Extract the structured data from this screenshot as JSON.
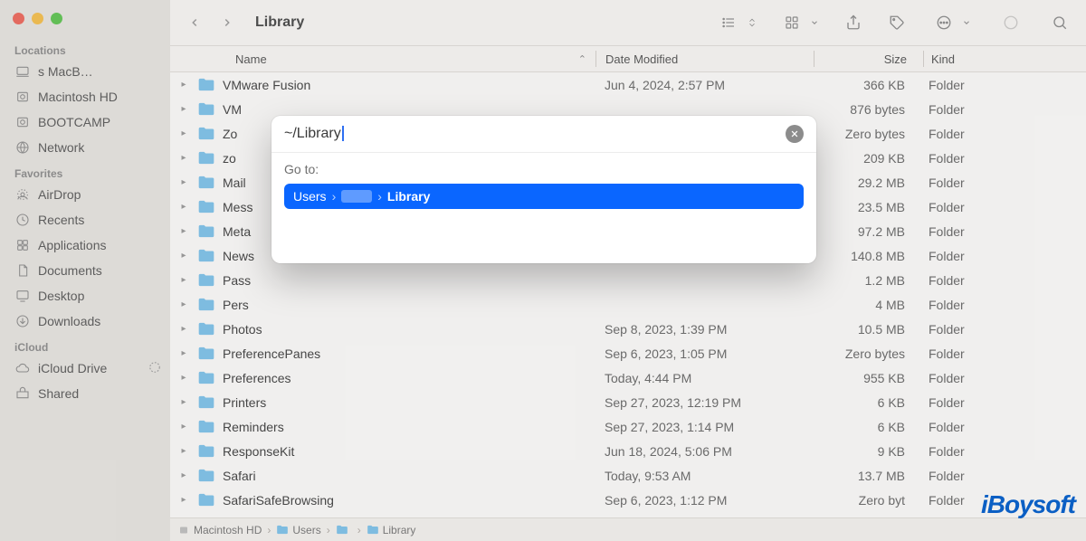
{
  "window": {
    "title": "Library"
  },
  "traffic_lights": {
    "colors": [
      "#ed6a5e",
      "#f5bf4f",
      "#61c554"
    ]
  },
  "sidebar": {
    "sections": [
      {
        "title": "Locations",
        "items": [
          {
            "label": "s MacB…",
            "icon": "laptop"
          },
          {
            "label": "Macintosh HD",
            "icon": "hdd"
          },
          {
            "label": "BOOTCAMP",
            "icon": "hdd"
          },
          {
            "label": "Network",
            "icon": "globe"
          }
        ]
      },
      {
        "title": "Favorites",
        "items": [
          {
            "label": "AirDrop",
            "icon": "airdrop"
          },
          {
            "label": "Recents",
            "icon": "clock"
          },
          {
            "label": "Applications",
            "icon": "apps"
          },
          {
            "label": "Documents",
            "icon": "doc"
          },
          {
            "label": "Desktop",
            "icon": "desktop"
          },
          {
            "label": "Downloads",
            "icon": "download"
          }
        ]
      },
      {
        "title": "iCloud",
        "items": [
          {
            "label": "iCloud Drive",
            "icon": "icloud",
            "badge": "sync"
          },
          {
            "label": "Shared",
            "icon": "shared"
          }
        ]
      }
    ]
  },
  "columns": {
    "name": "Name",
    "date": "Date Modified",
    "size": "Size",
    "kind": "Kind"
  },
  "rows": [
    {
      "name": "VMware Fusion",
      "date": "Jun 4, 2024, 2:57 PM",
      "size": "366 KB",
      "kind": "Folder"
    },
    {
      "name": "VM",
      "date": "",
      "size": "876 bytes",
      "kind": "Folder"
    },
    {
      "name": "Zo",
      "date": "",
      "size": "Zero bytes",
      "kind": "Folder"
    },
    {
      "name": "zo",
      "date": "",
      "size": "209 KB",
      "kind": "Folder"
    },
    {
      "name": "Mail",
      "date": "",
      "size": "29.2 MB",
      "kind": "Folder"
    },
    {
      "name": "Mess",
      "date": "",
      "size": "23.5 MB",
      "kind": "Folder"
    },
    {
      "name": "Meta",
      "date": "",
      "size": "97.2 MB",
      "kind": "Folder"
    },
    {
      "name": "News",
      "date": "",
      "size": "140.8 MB",
      "kind": "Folder"
    },
    {
      "name": "Pass",
      "date": "",
      "size": "1.2 MB",
      "kind": "Folder"
    },
    {
      "name": "Pers",
      "date": "",
      "size": "4 MB",
      "kind": "Folder"
    },
    {
      "name": "Photos",
      "date": "Sep 8, 2023, 1:39 PM",
      "size": "10.5 MB",
      "kind": "Folder"
    },
    {
      "name": "PreferencePanes",
      "date": "Sep 6, 2023, 1:05 PM",
      "size": "Zero bytes",
      "kind": "Folder"
    },
    {
      "name": "Preferences",
      "date": "Today, 4:44 PM",
      "size": "955 KB",
      "kind": "Folder"
    },
    {
      "name": "Printers",
      "date": "Sep 27, 2023, 12:19 PM",
      "size": "6 KB",
      "kind": "Folder"
    },
    {
      "name": "Reminders",
      "date": "Sep 27, 2023, 1:14 PM",
      "size": "6 KB",
      "kind": "Folder"
    },
    {
      "name": "ResponseKit",
      "date": "Jun 18, 2024, 5:06 PM",
      "size": "9 KB",
      "kind": "Folder"
    },
    {
      "name": "Safari",
      "date": "Today, 9:53 AM",
      "size": "13.7 MB",
      "kind": "Folder"
    },
    {
      "name": "SafariSafeBrowsing",
      "date": "Sep 6, 2023, 1:12 PM",
      "size": "Zero byt",
      "kind": "Folder"
    }
  ],
  "pathbar": {
    "items": [
      {
        "label": "Macintosh HD",
        "icon": "hdd"
      },
      {
        "label": "Users",
        "icon": "folder"
      },
      {
        "label": "",
        "icon": "folder"
      },
      {
        "label": "Library",
        "icon": "folder"
      }
    ]
  },
  "dialog": {
    "input_value": "~/Library",
    "goto_label": "Go to:",
    "suggestion": {
      "seg1": "Users",
      "seg2_hidden": true,
      "seg3": "Library"
    }
  },
  "watermark": "iBoysoft"
}
